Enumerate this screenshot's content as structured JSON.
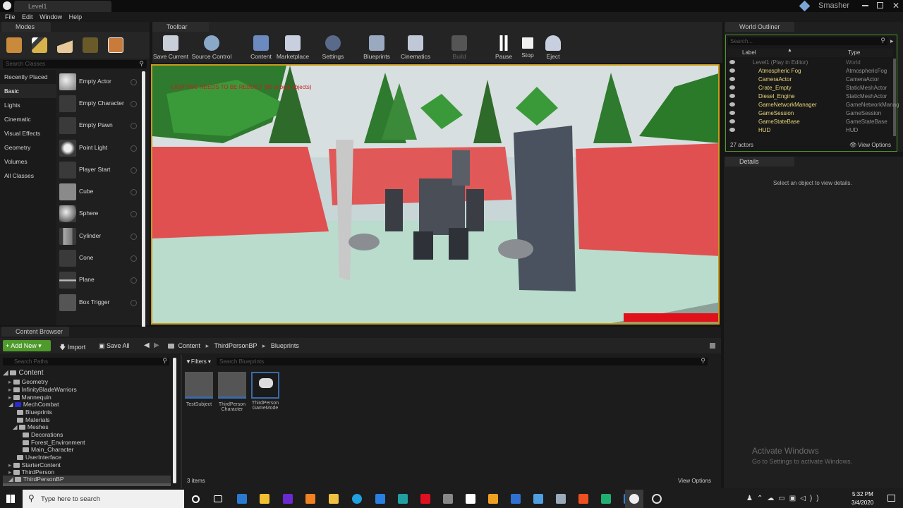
{
  "window": {
    "tab_title": "Level1",
    "project_name": "Smasher"
  },
  "menu": [
    "File",
    "Edit",
    "Window",
    "Help"
  ],
  "modes": {
    "tab_label": "Modes",
    "search_placeholder": "Search Classes",
    "categories": [
      "Recently Placed",
      "Basic",
      "Lights",
      "Cinematic",
      "Visual Effects",
      "Geometry",
      "Volumes",
      "All Classes"
    ],
    "actors": [
      "Empty Actor",
      "Empty Character",
      "Empty Pawn",
      "Point Light",
      "Player Start",
      "Cube",
      "Sphere",
      "Cylinder",
      "Cone",
      "Plane",
      "Box Trigger"
    ]
  },
  "toolbar": {
    "tab_label": "Toolbar",
    "buttons": [
      "Save Current",
      "Source Control",
      "Content",
      "Marketplace",
      "Settings",
      "Blueprints",
      "Cinematics",
      "Build",
      "Pause",
      "Stop",
      "Eject"
    ]
  },
  "viewport": {
    "warning": "LIGHTING NEEDS TO BE REBUILT (90 unbuilt objects)",
    "health": 1.0
  },
  "outliner": {
    "tab_label": "World Outliner",
    "search_placeholder": "Search...",
    "col_label": "Label",
    "col_type": "Type",
    "rows": [
      {
        "label": "Level1 (Play in Editor)",
        "type": "World"
      },
      {
        "label": "Atmospheric Fog",
        "type": "AtmosphericFog"
      },
      {
        "label": "CameraActor",
        "type": "CameraActor"
      },
      {
        "label": "Crate_Empty",
        "type": "StaticMeshActor"
      },
      {
        "label": "Diesel_Engine",
        "type": "StaticMeshActor"
      },
      {
        "label": "GameNetworkManager",
        "type": "GameNetworkManag"
      },
      {
        "label": "GameSession",
        "type": "GameSession"
      },
      {
        "label": "GameStateBase",
        "type": "GameStateBase"
      },
      {
        "label": "HUD",
        "type": "HUD"
      }
    ],
    "count": "27 actors",
    "view_options": "View Options"
  },
  "details": {
    "tab_label": "Details",
    "empty_message": "Select an object to view details."
  },
  "content_browser": {
    "tab_label": "Content Browser",
    "add_new": "Add New",
    "import": "Import",
    "save_all": "Save All",
    "breadcrumb": [
      "Content",
      "ThirdPersonBP",
      "Blueprints"
    ],
    "search_paths_placeholder": "Search Paths",
    "filters": "Filters",
    "search_placeholder": "Search Blueprints",
    "tree": [
      {
        "label": "Content",
        "depth": 0
      },
      {
        "label": "Geometry",
        "depth": 1
      },
      {
        "label": "InfinityBladeWarriors",
        "depth": 1
      },
      {
        "label": "Mannequin",
        "depth": 1
      },
      {
        "label": "MechCombat",
        "depth": 1
      },
      {
        "label": "Blueprints",
        "depth": 2
      },
      {
        "label": "Materials",
        "depth": 2
      },
      {
        "label": "Meshes",
        "depth": 2
      },
      {
        "label": "Decorations",
        "depth": 3
      },
      {
        "label": "Forest_Environment",
        "depth": 3
      },
      {
        "label": "Main_Character",
        "depth": 3
      },
      {
        "label": "UserInterface",
        "depth": 2
      },
      {
        "label": "StarterContent",
        "depth": 1
      },
      {
        "label": "ThirdPerson",
        "depth": 1
      },
      {
        "label": "ThirdPersonBP",
        "depth": 1
      }
    ],
    "assets": [
      {
        "line1": "TestSubject",
        "line2": ""
      },
      {
        "line1": "ThirdPerson",
        "line2": "Character"
      },
      {
        "line1": "ThirdPerson",
        "line2": "GameMode"
      }
    ],
    "item_count": "3 items",
    "view_options": "View Options"
  },
  "watermark": {
    "line1": "Activate Windows",
    "line2": "Go to Settings to activate Windows."
  },
  "taskbar": {
    "search_placeholder": "Type here to search",
    "time": "5:32 PM",
    "date": "3/4/2020"
  },
  "colors": {
    "accent": "#d5a21a",
    "add_new": "#4e9a2b",
    "health": "#e0111a"
  }
}
